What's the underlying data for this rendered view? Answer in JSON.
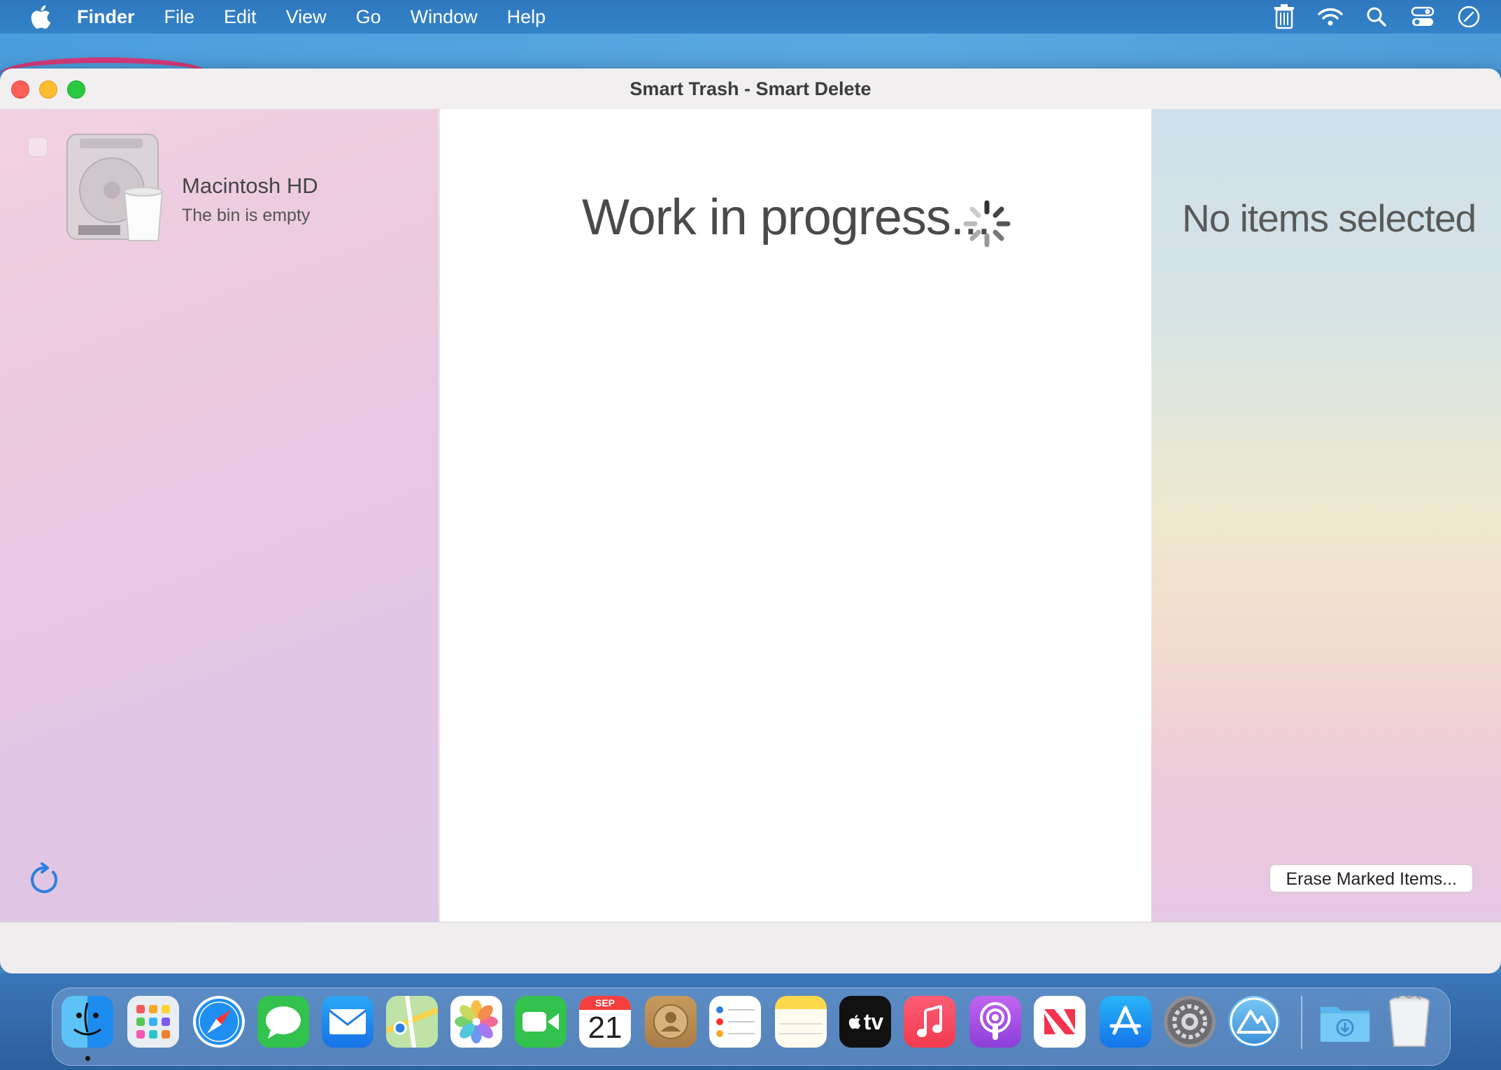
{
  "menubar": {
    "app_name": "Finder",
    "menus": [
      "File",
      "Edit",
      "View",
      "Go",
      "Window",
      "Help"
    ],
    "status_icons": [
      "trash-icon",
      "wifi-icon",
      "search-icon",
      "control-center-icon",
      "clock-icon"
    ]
  },
  "window": {
    "title": "Smart Trash - Smart Delete"
  },
  "left_pane": {
    "volume_name": "Macintosh HD",
    "volume_status": "The bin is empty"
  },
  "middle_pane": {
    "status_text": "Work in progress..."
  },
  "right_pane": {
    "status_text": "No items selected"
  },
  "bottom_bar": {
    "erase_button_label": "Erase Marked Items..."
  },
  "calendar": {
    "month": "SEP",
    "day": "21"
  },
  "tv_label": "tv",
  "dock_apps": [
    "finder",
    "launchpad",
    "safari",
    "messages",
    "mail",
    "maps",
    "photos",
    "facetime",
    "calendar",
    "contacts",
    "reminders",
    "notes",
    "tv",
    "music",
    "podcasts",
    "news",
    "app-store",
    "system-preferences",
    "cleanmymac",
    "downloads",
    "trash"
  ],
  "colors": {
    "accent": "#3483c8",
    "close": "#fe5f57",
    "minimize": "#febc2e",
    "maximize": "#28c840"
  }
}
